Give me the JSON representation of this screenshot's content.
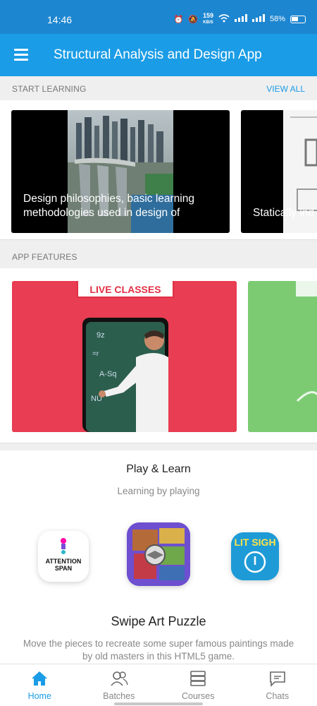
{
  "status": {
    "time": "14:46",
    "speed": "159",
    "speed_unit": "KB/S",
    "battery": "58%"
  },
  "appbar": {
    "title": "Structural Analysis and Design App"
  },
  "start_learning": {
    "heading": "START LEARNING",
    "view_all": "VIEW ALL",
    "courses": [
      {
        "caption": "Design philosophies, basic learning methodologies used in design of"
      },
      {
        "caption": "Statically ind"
      }
    ]
  },
  "app_features": {
    "heading": "APP FEATURES",
    "cards": [
      {
        "tag": "LIVE CLASSES"
      }
    ]
  },
  "play": {
    "heading": "Play & Learn",
    "subheading": "Learning by playing",
    "games": [
      {
        "label": "ATTENTION SPAN"
      },
      {
        "label": ""
      },
      {
        "label": "LIT SIGH"
      }
    ],
    "selected_name": "Swipe Art Puzzle",
    "selected_desc": "Move the pieces to recreate some super famous paintings made by old masters in this HTML5 game."
  },
  "nav": [
    {
      "label": "Home",
      "icon": "home-icon",
      "active": true
    },
    {
      "label": "Batches",
      "icon": "users-icon",
      "active": false
    },
    {
      "label": "Courses",
      "icon": "books-icon",
      "active": false
    },
    {
      "label": "Chats",
      "icon": "chat-icon",
      "active": false
    }
  ],
  "colors": {
    "primary": "#1a9ce6",
    "status": "#1d86d0",
    "live": "#e22f44"
  }
}
